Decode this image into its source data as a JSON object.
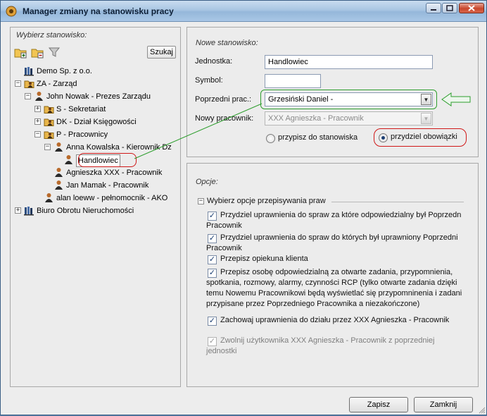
{
  "window": {
    "title": "Manager zmiany na stanowisku pracy"
  },
  "left": {
    "label": "Wybierz stanowisko:",
    "search_label": "Szukaj",
    "tree": [
      {
        "label": "Demo Sp. z o.o.",
        "icon": "company-books-icon",
        "level": 0,
        "expander": ""
      },
      {
        "label": "ZA - Zarząd",
        "icon": "department-icon",
        "level": 0,
        "expander": "-"
      },
      {
        "label": "John Nowak - Prezes Zarządu",
        "icon": "person-icon",
        "level": 1,
        "expander": "-"
      },
      {
        "label": "S - Sekretariat",
        "icon": "department-icon",
        "level": 2,
        "expander": "+"
      },
      {
        "label": "DK - Dział Księgowości",
        "icon": "department-icon",
        "level": 2,
        "expander": "+"
      },
      {
        "label": "P - Pracownicy",
        "icon": "department-icon",
        "level": 2,
        "expander": "-"
      },
      {
        "label": "Anna Kowalska - Kierownik Dz",
        "icon": "person-icon",
        "level": 3,
        "expander": "-"
      },
      {
        "label": "Handlowiec",
        "icon": "person-icon",
        "level": 4,
        "expander": "",
        "selected": true
      },
      {
        "label": "Agnieszka XXX - Pracownik",
        "icon": "person-icon",
        "level": 3,
        "expander": ""
      },
      {
        "label": "Jan Mamak - Pracownik",
        "icon": "person-icon",
        "level": 3,
        "expander": ""
      },
      {
        "label": "alan loeww - pełnomocnik - AKO",
        "icon": "person-icon",
        "level": 2,
        "expander": ""
      },
      {
        "label": "Biuro Obrotu Nieruchomości",
        "icon": "company-books-icon",
        "level": 0,
        "expander": "+"
      }
    ]
  },
  "form": {
    "label": "Nowe stanowisko:",
    "jednostka_label": "Jednostka:",
    "jednostka_value": "Handlowiec",
    "symbol_label": "Symbol:",
    "symbol_value": "",
    "poprzedni_label": "Poprzedni prac.:",
    "poprzedni_value": "Grzesiński Daniel -",
    "nowy_label": "Nowy pracownik:",
    "nowy_value": "XXX Agnieszka - Pracownik",
    "radio1_label": "przypisz do stanowiska",
    "radio2_label": "przydziel obowiązki",
    "selected_radio": "przydziel obowiązki"
  },
  "options": {
    "label": "Opcje:",
    "group_label": "Wybierz opcje przepisywania praw",
    "items": [
      {
        "lines": [
          "Przydziel uprawnienia do spraw za które odpowiedzialny był Poprzedn",
          "Pracownik"
        ],
        "checked": true,
        "enabled": true
      },
      {
        "lines": [
          "Przydziel uprawnienia do spraw do których był uprawniony Poprzedni",
          "Pracownik"
        ],
        "checked": true,
        "enabled": true
      },
      {
        "lines": [
          "Przepisz opiekuna klienta"
        ],
        "checked": true,
        "enabled": true
      },
      {
        "lines": [
          "Przepisz osobę odpowiedzialną za otwarte zadania, przypomnienia,",
          "spotkania, rozmowy, alarmy, czynności RCP (tylko otwarte zadania dzięki",
          "temu Nowemu Pracownikowi będą wyświetlać się przypomninenia i zadani",
          "przypisane przez Poprzedniego Pracownika a niezakończone)"
        ],
        "checked": true,
        "enabled": true
      },
      {
        "lines": [
          "Zachowaj uprawnienia do działu przez XXX Agnieszka - Pracownik"
        ],
        "checked": true,
        "enabled": true
      },
      {
        "lines": [
          "Zwolnij użytkownika XXX Agnieszka - Pracownik z poprzedniej",
          "jednostki"
        ],
        "checked": true,
        "enabled": false
      }
    ]
  },
  "buttons": {
    "save": "Zapisz",
    "close": "Zamknij"
  },
  "colors": {
    "accent": "#1b3e72",
    "annotation_red": "#d01818",
    "annotation_green": "#2e9e2e"
  }
}
